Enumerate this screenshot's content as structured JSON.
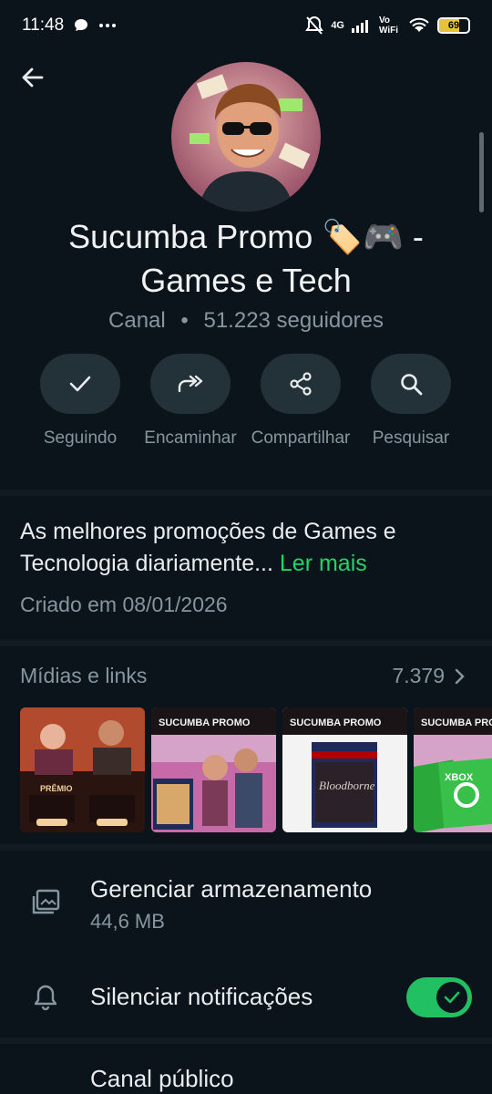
{
  "status_bar": {
    "time": "11:48",
    "network": "4G",
    "vowifi": "Vo WiFi",
    "battery_level": "69",
    "battery_percent": 0.69,
    "icons": [
      "chat-bubble-icon",
      "more-dots-icon",
      "mute-bell-icon",
      "signal-icon",
      "wifi-icon",
      "battery-icon"
    ]
  },
  "header": {
    "back_icon": "arrow-left-icon"
  },
  "channel": {
    "name": "Sucumba Promo 🏷️🎮  - Games e Tech",
    "type_label": "Canal",
    "separator": "•",
    "followers": "51.223 seguidores"
  },
  "actions": [
    {
      "label": "Seguindo",
      "icon": "check-icon"
    },
    {
      "label": "Encaminhar",
      "icon": "forward-icon"
    },
    {
      "label": "Compartilhar",
      "icon": "share-icon"
    },
    {
      "label": "Pesquisar",
      "icon": "search-icon"
    }
  ],
  "about": {
    "description": "As melhores promoções de Games e Tecnologia diariamente...",
    "read_more": "Ler mais",
    "created": "Criado em 08/01/2026"
  },
  "media": {
    "title": "Mídias e links",
    "count": "7.379",
    "thumbnails": [
      {
        "name": "media-thumb-1",
        "brand": "",
        "caption": "PRÊMIO"
      },
      {
        "name": "media-thumb-2",
        "brand": "SUCUMBA PROMO",
        "caption": ""
      },
      {
        "name": "media-thumb-3",
        "brand": "SUCUMBA PROMO",
        "caption": "Bloodborne"
      },
      {
        "name": "media-thumb-4",
        "brand": "SUCUMBA PROMO",
        "caption": "XBOX"
      }
    ]
  },
  "settings": {
    "storage": {
      "title": "Gerenciar armazenamento",
      "size": "44,6 MB",
      "icon": "storage-icon"
    },
    "mute": {
      "title": "Silenciar notificações",
      "enabled": true,
      "icon": "bell-icon"
    },
    "public": {
      "title": "Canal público"
    }
  },
  "colors": {
    "background": "#0b141a",
    "accent": "#25d366",
    "toggle": "#21c063",
    "muted_text": "#8696a0"
  }
}
